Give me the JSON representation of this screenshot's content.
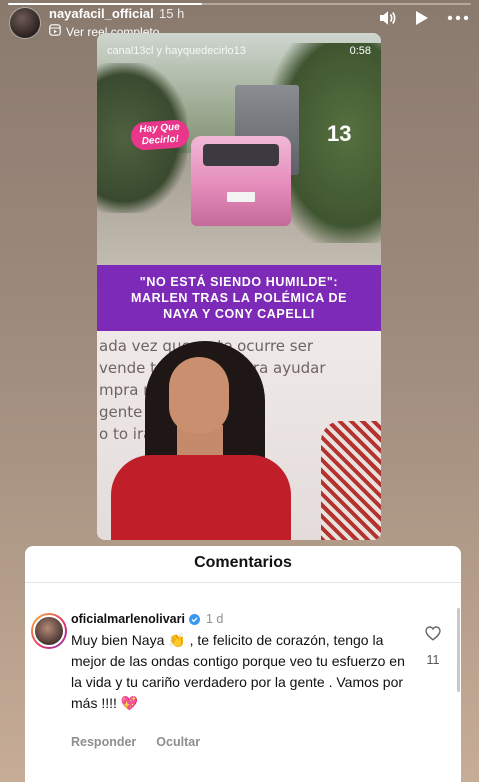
{
  "story": {
    "progress": 0.42,
    "username": "nayafacil_official",
    "time_ago": "15 h",
    "reel_link_label": "Ver reel completo",
    "icons": {
      "sound": "speaker-icon",
      "play": "play-icon",
      "more": "more-icon",
      "reel": "reel-icon"
    }
  },
  "reel": {
    "caption_top": "canal13cl y hayquedecirlo13",
    "duration": "0:58",
    "show_logo": "Hay Que Decirlo!",
    "channel_logo": "13",
    "headline_line1": "\"NO ESTÁ SIENDO HUMILDE\":",
    "headline_line2": "MARLEN TRAS LA POLÉMICA DE",
    "headline_line3": "NAYA Y CONY CAPELLI",
    "bg_text_1": "ada vez que se te ocurre ser",
    "bg_text_2": "vende t     lo de lujo para ayudar",
    "bg_text_3": "mpra      mente nada",
    "bg_text_4": "gente         se necesita",
    "bg_text_5": "o to             irando."
  },
  "comments": {
    "title": "Comentarios",
    "items": [
      {
        "username": "oficialmarlenolivari",
        "age": "1 d",
        "text": "Muy bien Naya 👏 , te felicito de corazón, tengo la mejor de las ondas contigo porque veo tu esfuerzo en la vida y tu cariño verdadero por la gente . Vamos por más !!!! 💖",
        "likes": "11",
        "reply_label": "Responder",
        "hide_label": "Ocultar"
      }
    ]
  }
}
